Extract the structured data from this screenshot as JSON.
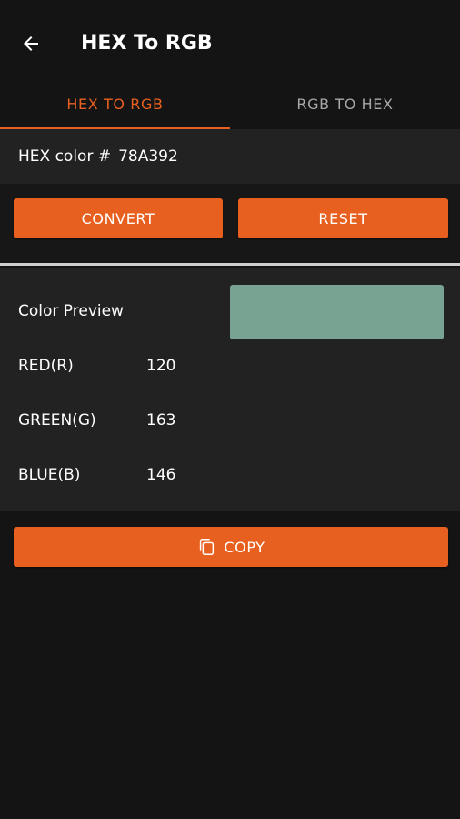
{
  "app_bar": {
    "title": "HEX To RGB"
  },
  "tabs": [
    {
      "label": "HEX TO RGB",
      "active": true
    },
    {
      "label": "RGB TO HEX",
      "active": false
    }
  ],
  "hex_input": {
    "label": "HEX color #",
    "value": "78A392"
  },
  "buttons": {
    "convert": "CONVERT",
    "reset": "RESET",
    "copy": "COPY"
  },
  "result": {
    "preview_label": "Color Preview",
    "preview_color": "#78A392",
    "red_label": "RED(R)",
    "red_value": "120",
    "green_label": "GREEN(G)",
    "green_value": "163",
    "blue_label": "BLUE(B)",
    "blue_value": "146"
  },
  "icons": {
    "back": "arrow-back-icon",
    "copy": "copy-icon"
  },
  "colors": {
    "accent": "#e8601f",
    "background": "#141414",
    "panel": "#222222"
  }
}
